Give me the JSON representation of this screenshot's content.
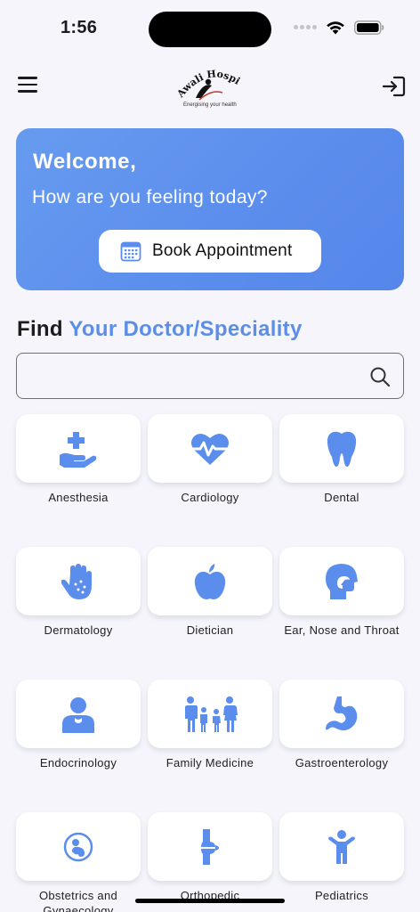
{
  "status_bar": {
    "time": "1:56"
  },
  "header": {
    "logo_text": "Awali Hospital",
    "logo_tagline": "Energising your health"
  },
  "welcome": {
    "title": "Welcome,",
    "subtitle": "How are you feeling today?",
    "book_button": "Book Appointment"
  },
  "find": {
    "prefix": "Find",
    "accent": "Your Doctor/Speciality"
  },
  "search": {
    "placeholder": "",
    "value": ""
  },
  "colors": {
    "accent": "#5d8ee6",
    "card": "#5b8ded",
    "icon": "#5b8ded"
  },
  "specialities": [
    {
      "label": "Anesthesia",
      "icon": "hand-medical-icon"
    },
    {
      "label": "Cardiology",
      "icon": "heart-pulse-icon"
    },
    {
      "label": "Dental",
      "icon": "tooth-icon"
    },
    {
      "label": "Dermatology",
      "icon": "hand-dots-icon"
    },
    {
      "label": "Dietician",
      "icon": "apple-icon"
    },
    {
      "label": "Ear, Nose and Throat",
      "icon": "head-side-icon"
    },
    {
      "label": "Endocrinology",
      "icon": "person-thyroid-icon"
    },
    {
      "label": "Family Medicine",
      "icon": "family-icon"
    },
    {
      "label": "Gastroenterology",
      "icon": "stomach-icon"
    },
    {
      "label": "Obstetrics and Gynaecology",
      "icon": "baby-icon"
    },
    {
      "label": "Orthopedic",
      "icon": "bone-icon"
    },
    {
      "label": "Pediatrics",
      "icon": "child-icon"
    }
  ]
}
